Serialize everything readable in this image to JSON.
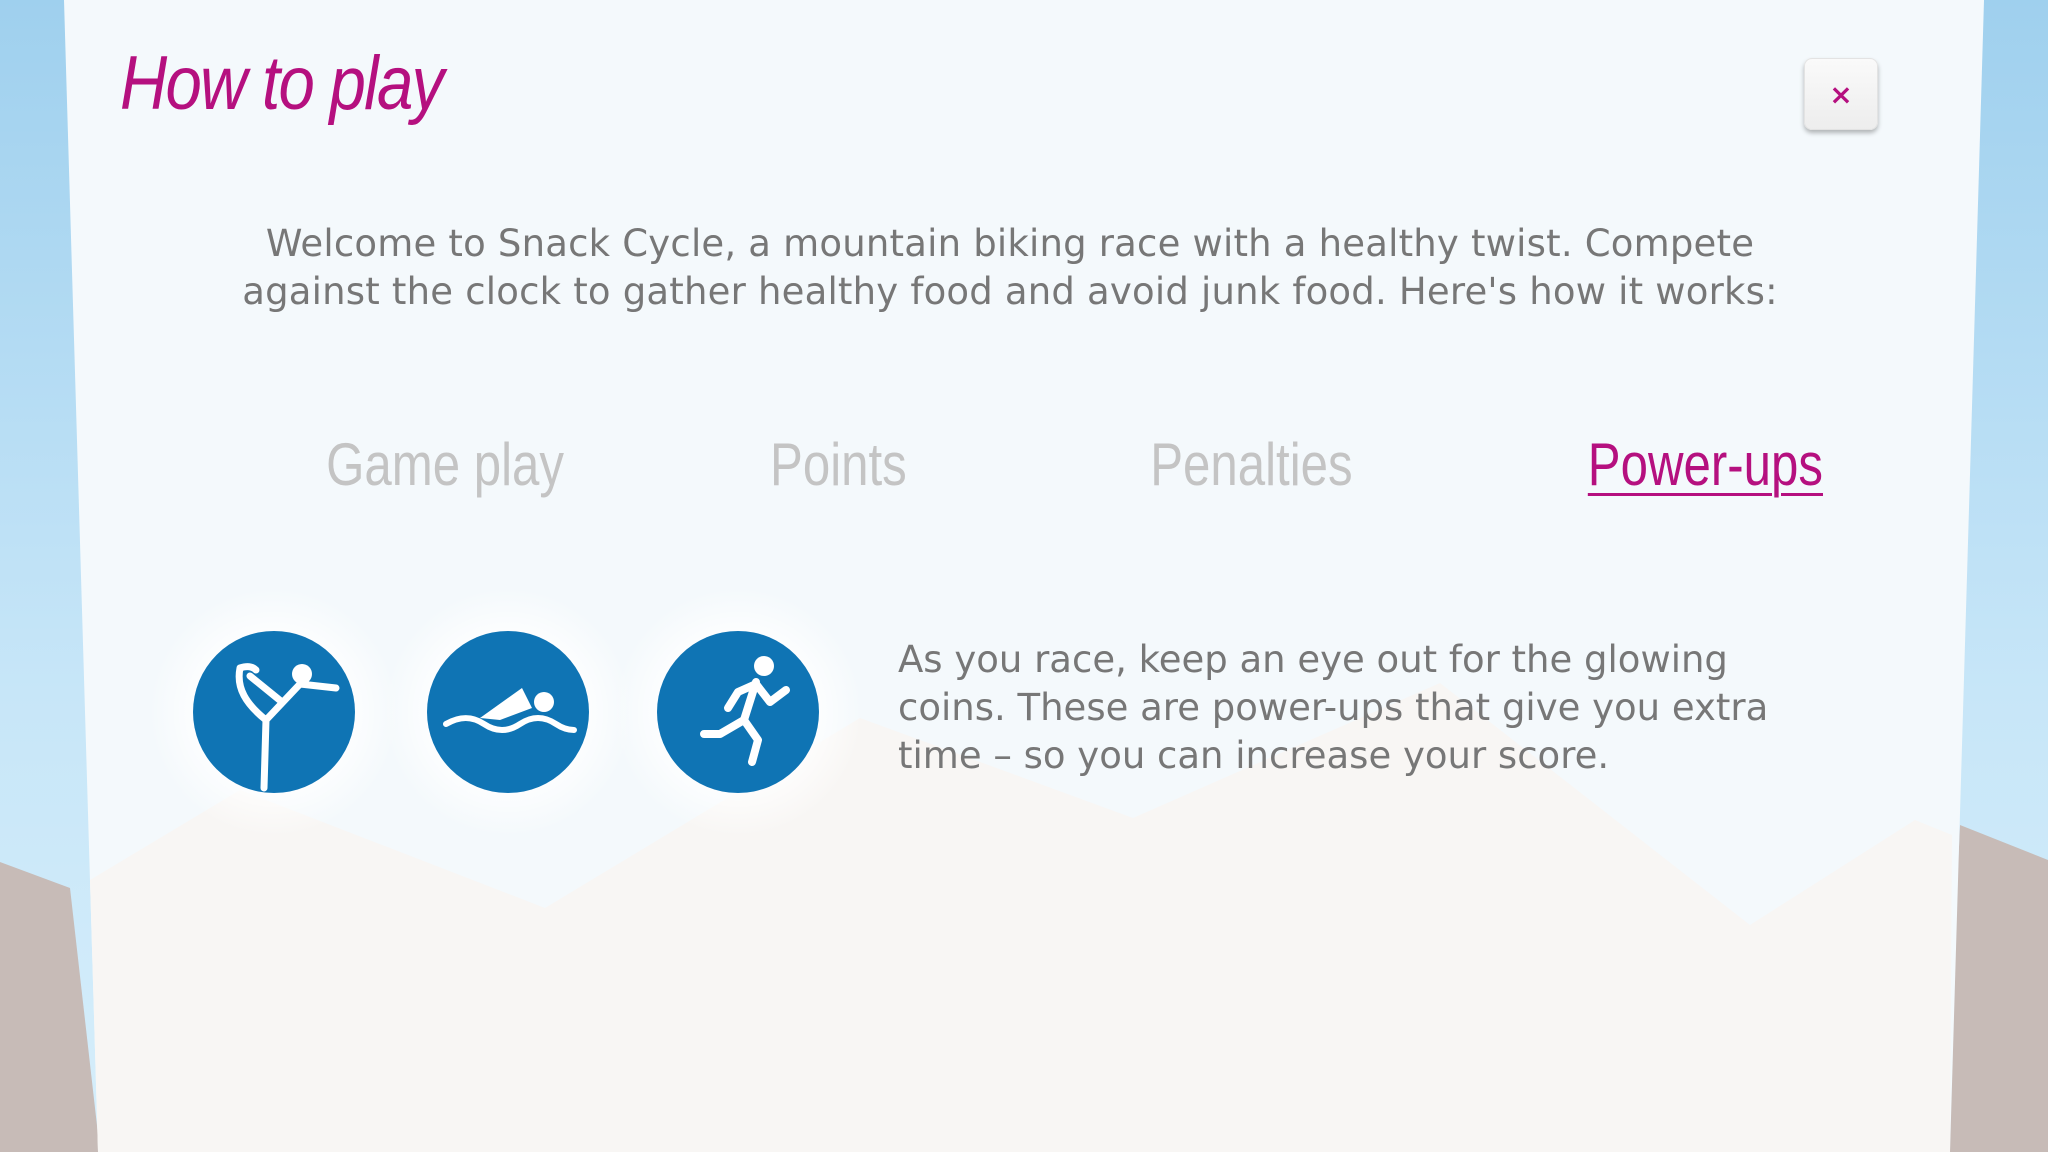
{
  "dialog": {
    "title": "How to play",
    "close_label": "×",
    "intro": "Welcome to Snack Cycle, a mountain biking race with a healthy twist. Compete against the clock to gather healthy food and avoid junk food. Here's how it works:"
  },
  "tabs": [
    {
      "label": "Game play",
      "active": false
    },
    {
      "label": "Points",
      "active": false
    },
    {
      "label": "Penalties",
      "active": false
    },
    {
      "label": "Power-ups",
      "active": true
    }
  ],
  "powerups": {
    "icons": [
      "yoga-coin-icon",
      "swimming-coin-icon",
      "running-coin-icon"
    ],
    "description": "As you race, keep an eye out for the glowing coins. These are power-ups that give you extra time – so you can increase your score."
  },
  "colors": {
    "accent": "#b5107f",
    "coin": "#0f74b4",
    "panel": "#f4f9fc",
    "inactive_tab": "#c4c4c4",
    "body_text": "#777777"
  }
}
